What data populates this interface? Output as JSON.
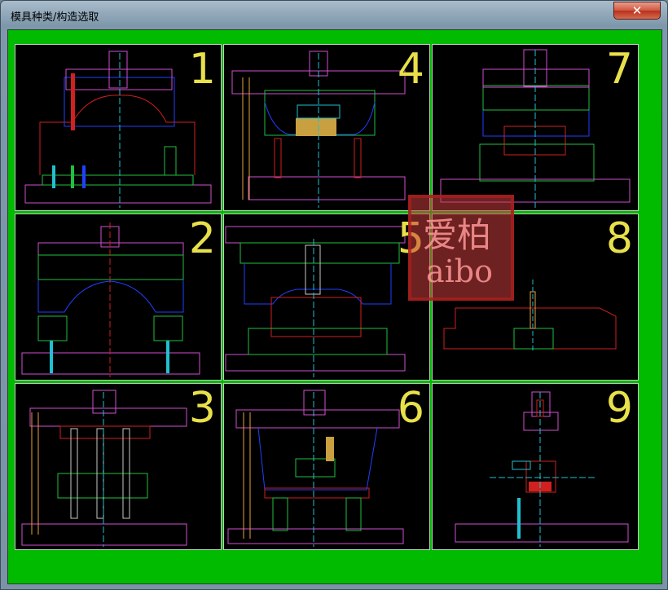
{
  "window": {
    "title": "模具种类/构造选取",
    "close_glyph": "✕"
  },
  "options": [
    {
      "number": "1"
    },
    {
      "number": "4"
    },
    {
      "number": "7"
    },
    {
      "number": "2"
    },
    {
      "number": "5"
    },
    {
      "number": "8"
    },
    {
      "number": "3"
    },
    {
      "number": "6"
    },
    {
      "number": "9"
    }
  ],
  "watermark": {
    "line1": "爱柏",
    "line2": "aibo"
  },
  "colors": {
    "client_bg": "#00bb00",
    "cell_bg": "#000000",
    "number": "#e8e04a"
  }
}
